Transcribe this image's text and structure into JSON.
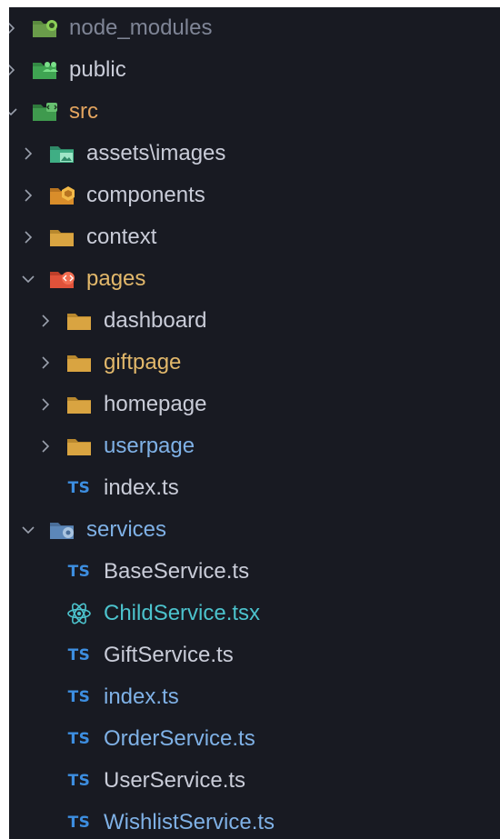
{
  "explorer": {
    "items": [
      {
        "label": "node_modules",
        "depth": 0,
        "expanded": false,
        "icon": "node-modules-folder-icon",
        "tone": "dim"
      },
      {
        "label": "public",
        "depth": 0,
        "expanded": false,
        "icon": "public-folder-icon",
        "tone": "normal"
      },
      {
        "label": "src",
        "depth": 0,
        "expanded": true,
        "icon": "src-folder-icon",
        "tone": "src"
      },
      {
        "label": "assets\\images",
        "depth": 1,
        "expanded": false,
        "icon": "images-folder-icon",
        "tone": "normal"
      },
      {
        "label": "components",
        "depth": 1,
        "expanded": false,
        "icon": "components-folder-icon",
        "tone": "normal"
      },
      {
        "label": "context",
        "depth": 1,
        "expanded": false,
        "icon": "folder-icon",
        "tone": "normal"
      },
      {
        "label": "pages",
        "depth": 1,
        "expanded": true,
        "icon": "pages-folder-icon",
        "tone": "modified"
      },
      {
        "label": "dashboard",
        "depth": 2,
        "expanded": false,
        "icon": "folder-icon",
        "tone": "normal"
      },
      {
        "label": "giftpage",
        "depth": 2,
        "expanded": false,
        "icon": "folder-icon",
        "tone": "modified"
      },
      {
        "label": "homepage",
        "depth": 2,
        "expanded": false,
        "icon": "folder-icon",
        "tone": "normal"
      },
      {
        "label": "userpage",
        "depth": 2,
        "expanded": false,
        "icon": "folder-icon",
        "tone": "tsfile"
      },
      {
        "label": "index.ts",
        "depth": 2,
        "file": true,
        "icon": "typescript-icon",
        "badge": "TS",
        "tone": "normal"
      },
      {
        "label": "services",
        "depth": 1,
        "expanded": true,
        "icon": "services-folder-icon",
        "tone": "tsfile"
      },
      {
        "label": "BaseService.ts",
        "depth": 2,
        "file": true,
        "icon": "typescript-icon",
        "badge": "TS",
        "tone": "normal"
      },
      {
        "label": "ChildService.tsx",
        "depth": 2,
        "file": true,
        "icon": "react-icon",
        "tone": "react"
      },
      {
        "label": "GiftService.ts",
        "depth": 2,
        "file": true,
        "icon": "typescript-icon",
        "badge": "TS",
        "tone": "normal"
      },
      {
        "label": "index.ts",
        "depth": 2,
        "file": true,
        "icon": "typescript-icon",
        "badge": "TS",
        "tone": "tsfile"
      },
      {
        "label": "OrderService.ts",
        "depth": 2,
        "file": true,
        "icon": "typescript-icon",
        "badge": "TS",
        "tone": "tsfile"
      },
      {
        "label": "UserService.ts",
        "depth": 2,
        "file": true,
        "icon": "typescript-icon",
        "badge": "TS",
        "tone": "normal"
      },
      {
        "label": "WishlistService.ts",
        "depth": 2,
        "file": true,
        "icon": "typescript-icon",
        "badge": "TS",
        "tone": "tsfile"
      }
    ]
  },
  "colors": {
    "background": "#181a22",
    "text": "#c9ccd8",
    "dim_text": "#7f8596",
    "modified": "#e2b86b",
    "react": "#4cc3cd",
    "ts_badge": "#3d8ee0",
    "folder": "#d9a441"
  }
}
